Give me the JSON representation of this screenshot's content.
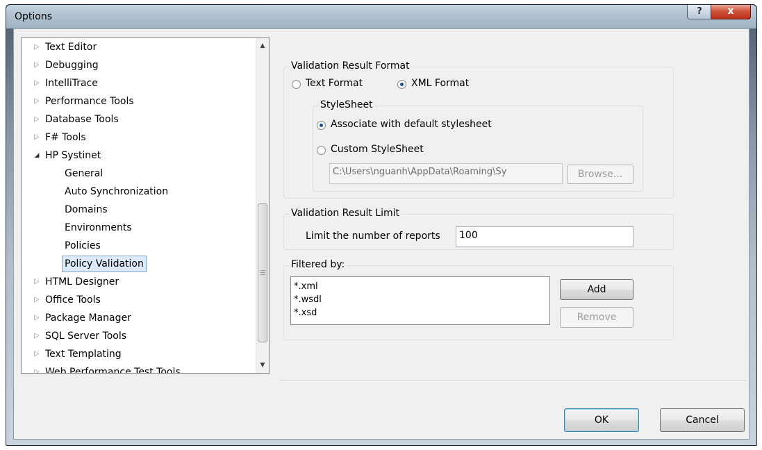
{
  "window": {
    "title": "Options",
    "help_glyph": "?",
    "close_glyph": "x"
  },
  "tree": {
    "items": [
      {
        "label": "Text Editor",
        "level": 0,
        "expanded": false
      },
      {
        "label": "Debugging",
        "level": 0,
        "expanded": false
      },
      {
        "label": "IntelliTrace",
        "level": 0,
        "expanded": false
      },
      {
        "label": "Performance Tools",
        "level": 0,
        "expanded": false
      },
      {
        "label": "Database Tools",
        "level": 0,
        "expanded": false
      },
      {
        "label": "F# Tools",
        "level": 0,
        "expanded": false
      },
      {
        "label": "HP Systinet",
        "level": 0,
        "expanded": true
      },
      {
        "label": "General",
        "level": 1
      },
      {
        "label": "Auto Synchronization",
        "level": 1
      },
      {
        "label": "Domains",
        "level": 1
      },
      {
        "label": "Environments",
        "level": 1
      },
      {
        "label": "Policies",
        "level": 1
      },
      {
        "label": "Policy Validation",
        "level": 1,
        "selected": true
      },
      {
        "label": "HTML Designer",
        "level": 0,
        "expanded": false
      },
      {
        "label": "Office Tools",
        "level": 0,
        "expanded": false
      },
      {
        "label": "Package Manager",
        "level": 0,
        "expanded": false
      },
      {
        "label": "SQL Server Tools",
        "level": 0,
        "expanded": false
      },
      {
        "label": "Text Templating",
        "level": 0,
        "expanded": false
      },
      {
        "label": "Web Performance Test Tools",
        "level": 0,
        "expanded": false
      }
    ]
  },
  "result_format": {
    "legend": "Validation Result Format",
    "text_format_label": "Text Format",
    "xml_format_label": "XML Format",
    "selected": "xml",
    "stylesheet": {
      "legend": "StyleSheet",
      "default_label": "Associate with default stylesheet",
      "custom_label": "Custom StyleSheet",
      "selected": "default",
      "path_value": "C:\\Users\\nguanh\\AppData\\Roaming\\Sy",
      "browse_label": "Browse..."
    }
  },
  "result_limit": {
    "legend": "Validation Result Limit",
    "label": "Limit the number of reports",
    "value": "100"
  },
  "filter": {
    "legend": "Filtered by:",
    "items": [
      "*.xml",
      "*.wsdl",
      "*.xsd"
    ],
    "add_label": "Add",
    "remove_label": "Remove"
  },
  "footer": {
    "ok_label": "OK",
    "cancel_label": "Cancel"
  },
  "colors": {
    "selection": "#dceaf9",
    "close_button": "#c8442c"
  }
}
